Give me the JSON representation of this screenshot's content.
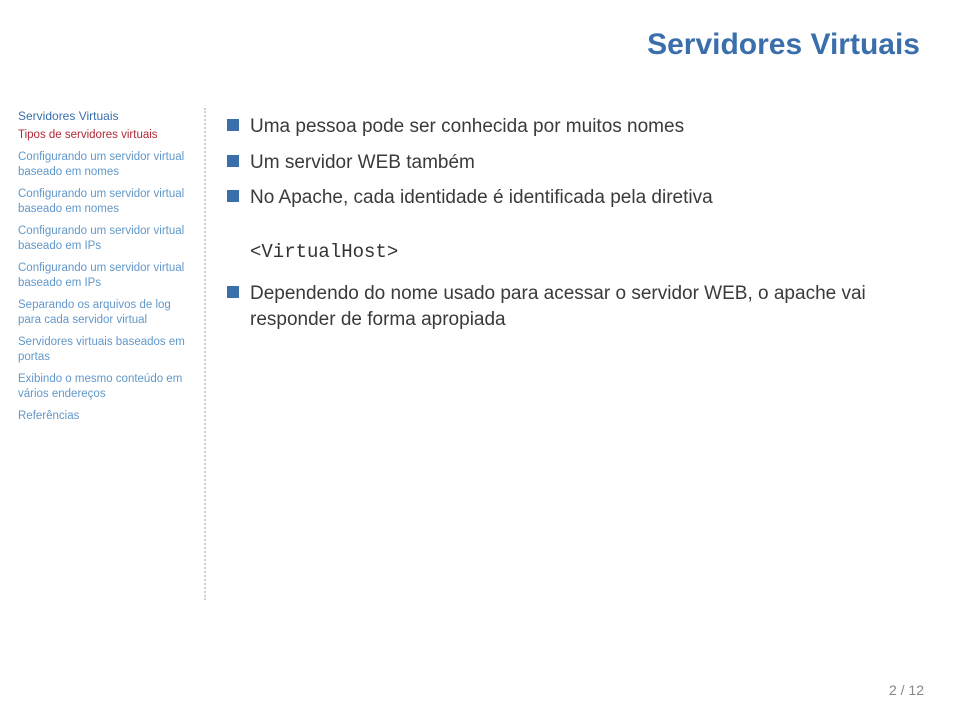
{
  "title": "Servidores Virtuais",
  "page": {
    "current": "2",
    "total": "12",
    "sep": " / "
  },
  "sidebar": {
    "section_head": "Servidores Virtuais",
    "current": "Tipos de servidores virtuais",
    "items": [
      "Configurando um servidor virtual baseado em nomes",
      "Configurando um servidor virtual baseado em nomes",
      "Configurando um servidor virtual baseado em IPs",
      "Configurando um servidor virtual baseado em IPs",
      "Separando os arquivos de log para cada servidor virtual",
      "Servidores virtuais baseados em portas",
      "Exibindo o mesmo conteúdo em vários endereços",
      "Referências"
    ]
  },
  "bullets_top": [
    "Uma pessoa pode ser conhecida por muitos nomes",
    "Um servidor WEB também",
    "No Apache, cada identidade é identificada pela diretiva"
  ],
  "code": "<VirtualHost>",
  "bullets_bottom": [
    "Dependendo do nome usado para acessar o servidor WEB, o apache vai responder de forma apropiada"
  ]
}
